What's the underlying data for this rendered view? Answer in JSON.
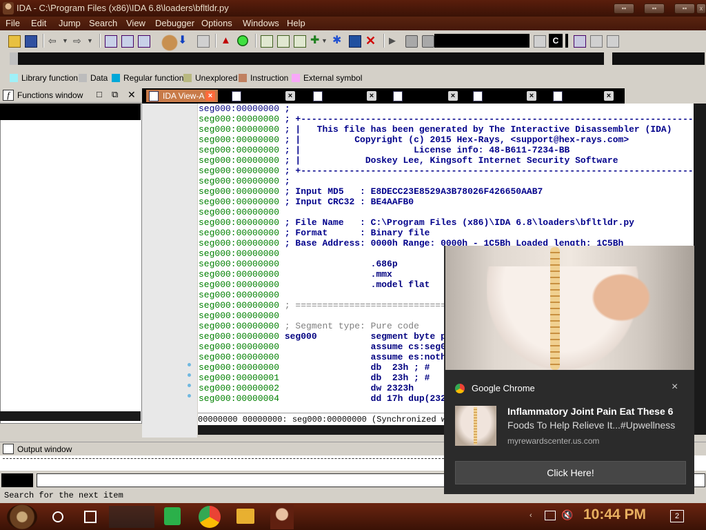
{
  "window": {
    "title": "IDA - C:\\Program Files (x86)\\IDA 6.8\\loaders\\bfltldr.py"
  },
  "menu": [
    "File",
    "Edit",
    "Jump",
    "Search",
    "View",
    "Debugger",
    "Options",
    "Windows",
    "Help"
  ],
  "legend": [
    {
      "label": "Library function",
      "color": "#9ff0f8"
    },
    {
      "label": "Data",
      "color": "#bcbcbc"
    },
    {
      "label": "Regular function",
      "color": "#00a8d8"
    },
    {
      "label": "Unexplored",
      "color": "#b8b880"
    },
    {
      "label": "Instruction",
      "color": "#c08060"
    },
    {
      "label": "External symbol",
      "color": "#f8a8f8"
    }
  ],
  "functions_window": {
    "title": "Functions window"
  },
  "tabs": [
    {
      "label": "IDA View-A"
    }
  ],
  "disasm": {
    "lines": [
      {
        "addr": "seg000:00000000",
        "text": " ;"
      },
      {
        "addr": "seg000:00000000",
        "text": " ; +-------------------------------------------------------------------------+"
      },
      {
        "addr": "seg000:00000000",
        "text": " ; |   This file has been generated by The Interactive Disassembler (IDA)    |"
      },
      {
        "addr": "seg000:00000000",
        "text": " ; |          Copyright (c) 2015 Hex-Rays, <support@hex-rays.com>            |"
      },
      {
        "addr": "seg000:00000000",
        "text": " ; |                     License info: 48-B611-7234-BB                       |"
      },
      {
        "addr": "seg000:00000000",
        "text": " ; |            Doskey Lee, Kingsoft Internet Security Software              |"
      },
      {
        "addr": "seg000:00000000",
        "text": " ; +-------------------------------------------------------------------------+"
      },
      {
        "addr": "seg000:00000000",
        "text": " ;"
      },
      {
        "addr": "seg000:00000000",
        "text": " ; Input MD5   : E8DECC23E8529A3B78026F426650AAB7"
      },
      {
        "addr": "seg000:00000000",
        "text": " ; Input CRC32 : BE4AAFB0"
      },
      {
        "addr": "seg000:00000000",
        "text": ""
      },
      {
        "addr": "seg000:00000000",
        "text": " ; File Name   : C:\\Program Files (x86)\\IDA 6.8\\loaders\\bfltldr.py"
      },
      {
        "addr": "seg000:00000000",
        "text": " ; Format      : Binary file"
      },
      {
        "addr": "seg000:00000000",
        "text": " ; Base Address: 0000h Range: 0000h - 1C5Bh Loaded length: 1C5Bh"
      },
      {
        "addr": "seg000:00000000",
        "text": ""
      },
      {
        "addr": "seg000:00000000",
        "text": "                 .686p"
      },
      {
        "addr": "seg000:00000000",
        "text": "                 .mmx"
      },
      {
        "addr": "seg000:00000000",
        "text": "                 .model flat"
      },
      {
        "addr": "seg000:00000000",
        "text": ""
      },
      {
        "addr": "seg000:00000000",
        "text": " ; ==========================================================================="
      },
      {
        "addr": "seg000:00000000",
        "text": ""
      },
      {
        "addr": "seg000:00000000",
        "text": " ; Segment type: Pure code"
      },
      {
        "addr": "seg000:00000000",
        "text": " seg000          segment byte public 'CODE' use32"
      },
      {
        "addr": "seg000:00000000",
        "text": "                 assume cs:seg000"
      },
      {
        "addr": "seg000:00000000",
        "text": "                 assume es:nothing, ss:nothing, ds:nothing"
      },
      {
        "addr": "seg000:00000000",
        "text": "                 db  23h ; #"
      },
      {
        "addr": "seg000:00000001",
        "text": "                 db  23h ; #"
      },
      {
        "addr": "seg000:00000002",
        "text": "                 dw 2323h"
      },
      {
        "addr": "seg000:00000004",
        "text": "                 dd 17h dup(2323h)"
      }
    ],
    "status": "00000000 00000000: seg000:00000000 (Synchronized with Hex View-1)"
  },
  "output_window": {
    "title": "Output window"
  },
  "statusbar": {
    "text": "Search for the next item"
  },
  "taskbar": {
    "time": "10:44 PM",
    "notif_count": "2"
  },
  "toast": {
    "app": "Google Chrome",
    "title": "Inflammatory Joint Pain Eat These 6",
    "body": "Foods To Help Relieve It...#Upwellness",
    "source": "myrewardscenter.us.com",
    "button": "Click Here!",
    "close": "×"
  },
  "colors": {
    "title_bg": "#4a1808",
    "menu_bg": "#4f1c0c",
    "addr_green": "#008000",
    "comment_blue": "#00008b",
    "toast_bg": "#2b2b2b"
  }
}
